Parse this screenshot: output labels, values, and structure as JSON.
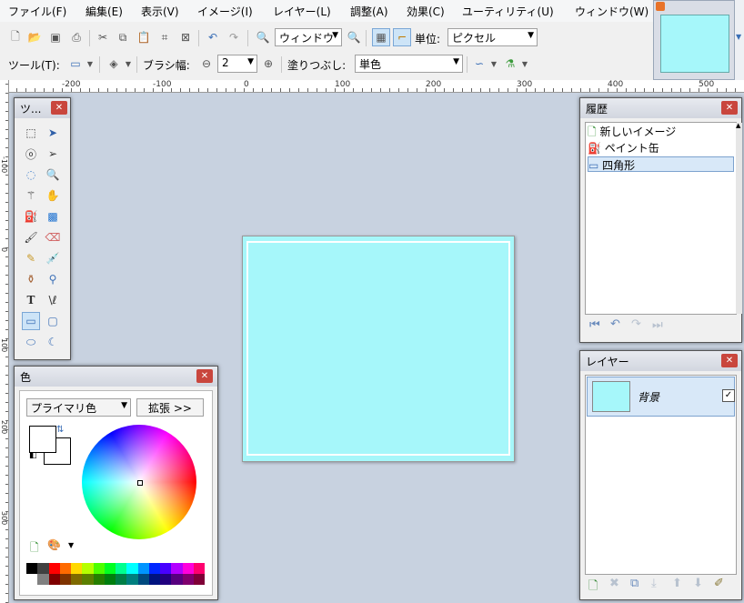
{
  "menu": [
    "ファイル(F)",
    "編集(E)",
    "表示(V)",
    "イメージ(I)",
    "レイヤー(L)",
    "調整(A)",
    "効果(C)",
    "ユーティリティ(U)",
    "ウィンドウ(W)"
  ],
  "toolbar1": {
    "zoom_value": "ウィンドウ",
    "unit_label": "単位:",
    "unit_value": "ピクセル"
  },
  "toolbar2": {
    "tool_label": "ツール(T):",
    "brush_label": "ブラシ幅:",
    "brush_value": "2",
    "fill_label": "塗りつぶし:",
    "fill_value": "単色"
  },
  "ruler": {
    "h_labels": [
      "-200",
      "-100",
      "0",
      "100",
      "200",
      "300",
      "400",
      "500"
    ],
    "v_labels": [
      "-100",
      "0",
      "100",
      "200",
      "300"
    ]
  },
  "tools_window": {
    "title": "ツ..."
  },
  "history_window": {
    "title": "履歴",
    "items": [
      "新しいイメージ",
      "ペイント缶",
      "四角形"
    ],
    "selected_index": 2
  },
  "layers_window": {
    "title": "レイヤー",
    "layer_name": "背景",
    "layer_visible": true
  },
  "colors_window": {
    "title": "色",
    "mode_value": "プライマリ色",
    "expand_label": "拡張 >>"
  },
  "colors": {
    "canvas_fill": "#a6f7fa",
    "workspace": "#c8d2e0",
    "close": "#c9463d",
    "palette_top": [
      "#000000",
      "#404040",
      "#ff0000",
      "#ff6a00",
      "#ffd800",
      "#b6ff00",
      "#4cff00",
      "#00ff21",
      "#00ff90",
      "#00ffff",
      "#0094ff",
      "#0026ff",
      "#4800ff",
      "#b200ff",
      "#ff00dc",
      "#ff006e"
    ],
    "palette_bottom": [
      "#ffffff",
      "#808080",
      "#7f0000",
      "#7f3300",
      "#7f6a00",
      "#5b7f00",
      "#267f00",
      "#007f0e",
      "#007f46",
      "#007f7f",
      "#004a7f",
      "#00137f",
      "#21007f",
      "#57007f",
      "#7f006e",
      "#7f0037"
    ]
  }
}
